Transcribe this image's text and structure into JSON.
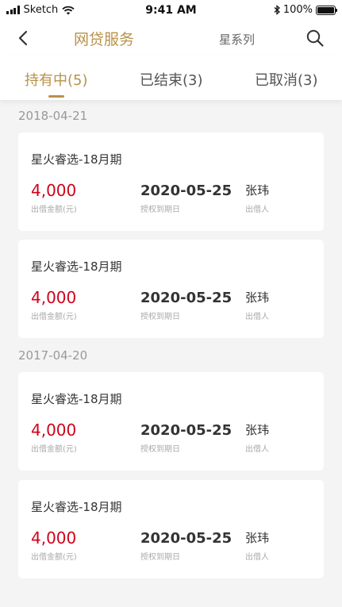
{
  "status_bar": {
    "carrier": "Sketch",
    "time": "9:41 AM",
    "battery": "100%"
  },
  "nav": {
    "title": "网贷服务",
    "subtitle": "星系列"
  },
  "tabs": [
    {
      "label": "持有中(5)"
    },
    {
      "label": "已结束(3)"
    },
    {
      "label": "已取消(3)"
    }
  ],
  "groups": [
    {
      "date": "2018-04-21",
      "cards": [
        {
          "product": "星火睿选-18月期",
          "amount": "4,000",
          "amount_label": "出借金额(元)",
          "expire_date": "2020-05-25",
          "expire_label": "授权到期日",
          "lender": "张玮",
          "lender_label": "出借人"
        },
        {
          "product": "星火睿选-18月期",
          "amount": "4,000",
          "amount_label": "出借金额(元)",
          "expire_date": "2020-05-25",
          "expire_label": "授权到期日",
          "lender": "张玮",
          "lender_label": "出借人"
        }
      ]
    },
    {
      "date": "2017-04-20",
      "cards": [
        {
          "product": "星火睿选-18月期",
          "amount": "4,000",
          "amount_label": "出借金额(元)",
          "expire_date": "2020-05-25",
          "expire_label": "授权到期日",
          "lender": "张玮",
          "lender_label": "出借人"
        },
        {
          "product": "星火睿选-18月期",
          "amount": "4,000",
          "amount_label": "出借金额(元)",
          "expire_date": "2020-05-25",
          "expire_label": "授权到期日",
          "lender": "张玮",
          "lender_label": "出借人"
        }
      ]
    }
  ],
  "icons": {
    "back": "chevron-left-icon",
    "search": "search-icon",
    "wifi": "wifi-icon",
    "bluetooth": "bluetooth-icon",
    "battery": "battery-icon",
    "signal": "signal-icon"
  },
  "colors": {
    "accent": "#b8924a",
    "amount": "#d0021b",
    "background": "#f4f4f4"
  }
}
